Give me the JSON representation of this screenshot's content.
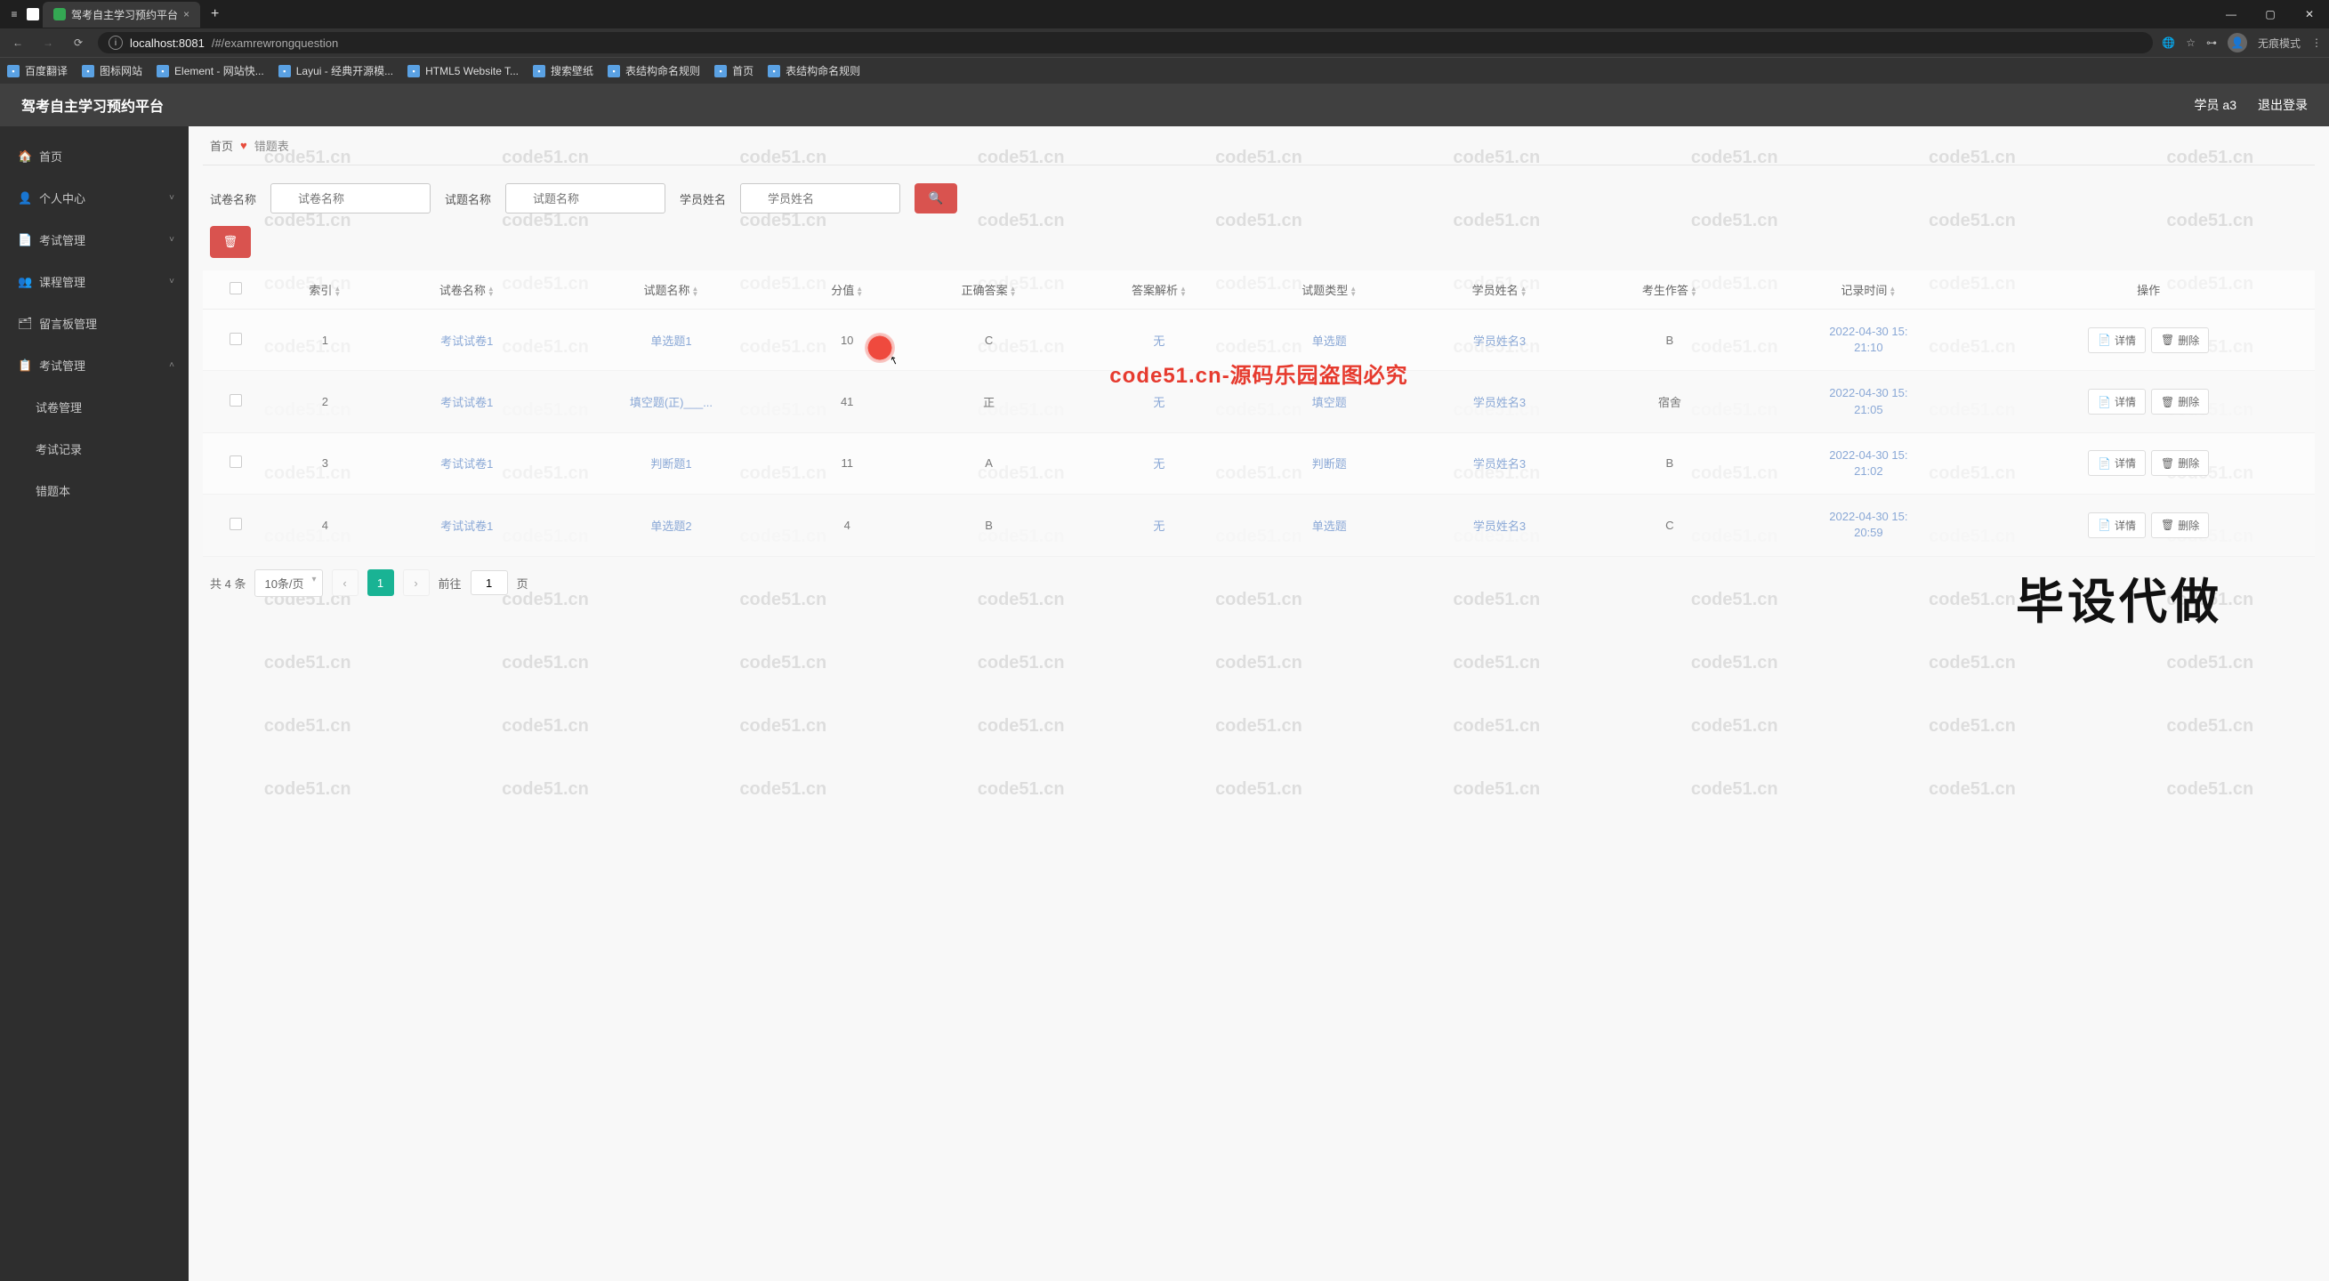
{
  "browser": {
    "tab_title": "驾考自主学习预约平台",
    "url_host": "localhost:8081",
    "url_path": "/#/examrewrongquestion",
    "profile_label": "无痕模式",
    "bookmarks": [
      {
        "label": "百度翻译"
      },
      {
        "label": "图标网站"
      },
      {
        "label": "Element - 网站快..."
      },
      {
        "label": "Layui - 经典开源模..."
      },
      {
        "label": "HTML5 Website T..."
      },
      {
        "label": "搜索壁纸"
      },
      {
        "label": "表结构命名规则"
      },
      {
        "label": "首页"
      },
      {
        "label": "表结构命名规则"
      }
    ]
  },
  "app": {
    "title": "驾考自主学习预约平台",
    "user_label": "学员 a3",
    "logout_label": "退出登录"
  },
  "sidebar": [
    {
      "label": "首页",
      "icon": "🏠"
    },
    {
      "label": "个人中心",
      "icon": "👤",
      "expandable": true
    },
    {
      "label": "考试管理",
      "icon": "📄",
      "expandable": true
    },
    {
      "label": "课程管理",
      "icon": "👥",
      "expandable": true
    },
    {
      "label": "留言板管理",
      "icon": "🗂"
    },
    {
      "label": "考试管理",
      "icon": "📋",
      "expandable": true,
      "open": true,
      "children": [
        {
          "label": "试卷管理"
        },
        {
          "label": "考试记录"
        },
        {
          "label": "错题本"
        }
      ]
    }
  ],
  "breadcrumb": {
    "home": "首页",
    "current": "错题表"
  },
  "filters": {
    "paper_name_label": "试卷名称",
    "paper_name_ph": "试卷名称",
    "question_name_label": "试题名称",
    "question_name_ph": "试题名称",
    "student_name_label": "学员姓名",
    "student_name_ph": "学员姓名"
  },
  "table": {
    "headers": [
      "",
      "索引",
      "试卷名称",
      "试题名称",
      "分值",
      "正确答案",
      "答案解析",
      "试题类型",
      "学员姓名",
      "考生作答",
      "记录时间",
      "操作"
    ],
    "rows": [
      {
        "idx": "1",
        "paper": "考试试卷1",
        "question": "单选题1",
        "score": "10",
        "correct": "C",
        "analysis": "无",
        "type": "单选题",
        "student": "学员姓名3",
        "answer": "B",
        "time": "2022-04-30 15:21:10"
      },
      {
        "idx": "2",
        "paper": "考试试卷1",
        "question": "填空题(正)___...",
        "score": "41",
        "correct": "正",
        "analysis": "无",
        "type": "填空题",
        "student": "学员姓名3",
        "answer": "宿舍",
        "time": "2022-04-30 15:21:05"
      },
      {
        "idx": "3",
        "paper": "考试试卷1",
        "question": "判断题1",
        "score": "11",
        "correct": "A",
        "analysis": "无",
        "type": "判断题",
        "student": "学员姓名3",
        "answer": "B",
        "time": "2022-04-30 15:21:02"
      },
      {
        "idx": "4",
        "paper": "考试试卷1",
        "question": "单选题2",
        "score": "4",
        "correct": "B",
        "analysis": "无",
        "type": "单选题",
        "student": "学员姓名3",
        "answer": "C",
        "time": "2022-04-30 15:20:59"
      }
    ],
    "detail_label": "详情",
    "delete_label": "删除"
  },
  "pager": {
    "total_label": "共 4 条",
    "per_page": "10条/页",
    "current": "1",
    "goto_prefix": "前往",
    "goto_value": "1",
    "goto_suffix": "页"
  },
  "watermark": {
    "text": "code51.cn",
    "center": "code51.cn-源码乐园盗图必究",
    "big": "毕设代做"
  }
}
